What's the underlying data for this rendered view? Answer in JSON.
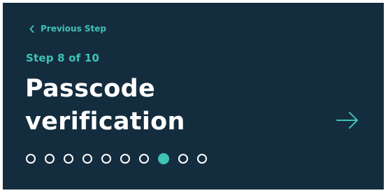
{
  "colors": {
    "background": "#142d3e",
    "accent": "#3ec3b4",
    "text": "#ffffff"
  },
  "nav": {
    "previous_label": "Previous Step",
    "previous_icon": "chevron-left-icon",
    "next_icon": "arrow-right-icon"
  },
  "step": {
    "label": "Step 8 of 10",
    "current": 8,
    "total": 10
  },
  "title": {
    "line1": "Passcode",
    "line2": "verification"
  }
}
